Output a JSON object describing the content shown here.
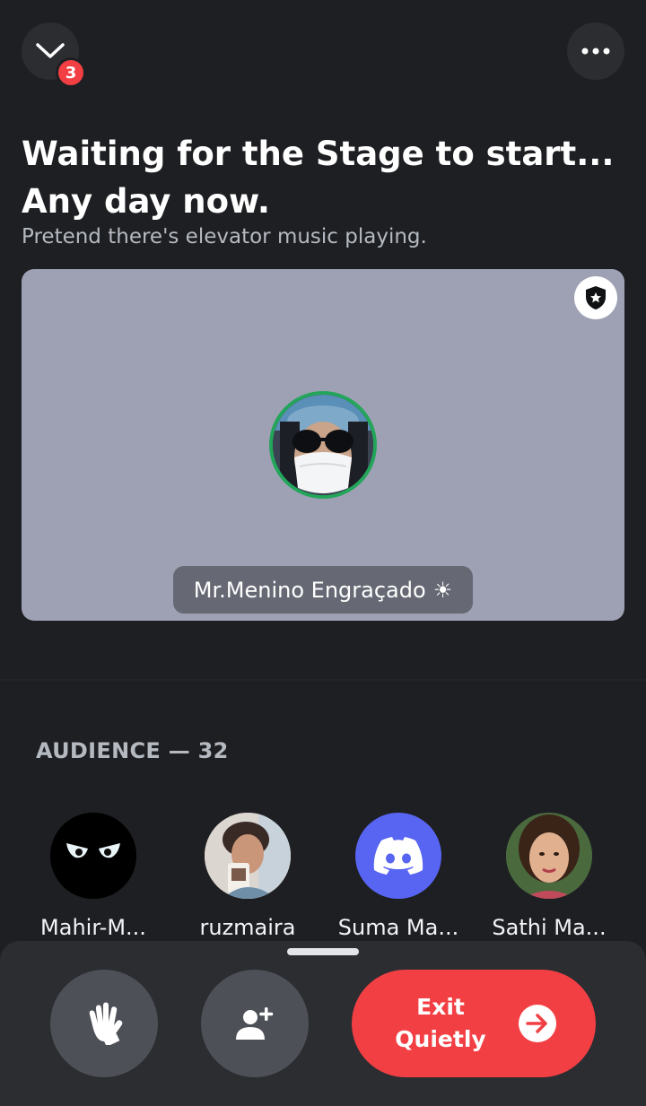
{
  "header": {
    "collapse_icon": "chevron-down-icon",
    "notification_count": "3",
    "more_icon": "more-horizontal-icon"
  },
  "stage": {
    "title_line1": "Waiting for the Stage to start...",
    "title_line2": "Any day now.",
    "subtitle": "Pretend there's elevator music playing.",
    "card_color": "#9ea1b4",
    "moderator_icon": "shield-star-icon",
    "speaker": {
      "name": "Mr.Menino Engraçado",
      "status_emoji": "☀",
      "ring_color": "#23a55a"
    }
  },
  "audience": {
    "header": "AUDIENCE — 32",
    "members": [
      {
        "name": "Mahir-M..."
      },
      {
        "name": "ruzmaira"
      },
      {
        "name": "Suma Ma..."
      },
      {
        "name": "Sathi Ma..."
      }
    ]
  },
  "controls": {
    "raise_hand_icon": "raise-hand-icon",
    "invite_icon": "add-user-icon",
    "exit_label_line1": "Exit",
    "exit_label_line2": "Quietly",
    "exit_icon": "arrow-right-circle-icon",
    "exit_color": "#f23f43"
  }
}
